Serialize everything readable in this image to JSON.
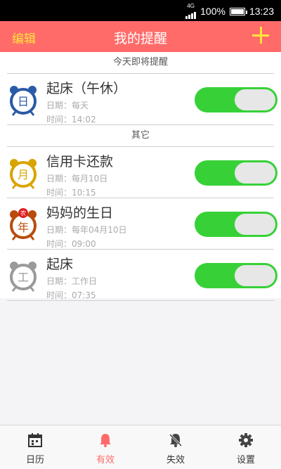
{
  "status": {
    "network": "4G",
    "battery": "100%",
    "time": "13:23"
  },
  "header": {
    "edit_label": "编辑",
    "title": "我的提醒",
    "add_icon": "plus-icon"
  },
  "sections": {
    "today": "今天即将提醒",
    "other": "其它"
  },
  "reminders": [
    {
      "icon_char": "日",
      "icon_color": "#2a5aa8",
      "name": "起床（午休）",
      "line1": "日期：每天",
      "line2": "时间：14:02",
      "enabled": true
    },
    {
      "icon_char": "月",
      "icon_color": "#d9a400",
      "name": "信用卡还款",
      "line1": "日期：每月10日",
      "line2": "时间：10:15",
      "enabled": true
    },
    {
      "icon_char": "年",
      "icon_color": "#b84c0c",
      "badge": "农",
      "name": "妈妈的生日",
      "line1": "日期：每年04月10日",
      "line2": "时间：09:00",
      "enabled": true
    },
    {
      "icon_char": "工",
      "icon_color": "#9a9a9a",
      "name": "起床",
      "line1": "日期：工作日",
      "line2": "时间：07:35",
      "enabled": true
    }
  ],
  "tabs": [
    {
      "label": "日历",
      "icon": "calendar-icon",
      "active": false
    },
    {
      "label": "有效",
      "icon": "bell-icon",
      "active": true
    },
    {
      "label": "失效",
      "icon": "bell-off-icon",
      "active": false
    },
    {
      "label": "设置",
      "icon": "gear-icon",
      "active": false
    }
  ],
  "colors": {
    "accent": "#ff6b69",
    "edit": "#ffe43c",
    "toggle_on": "#37d137"
  }
}
